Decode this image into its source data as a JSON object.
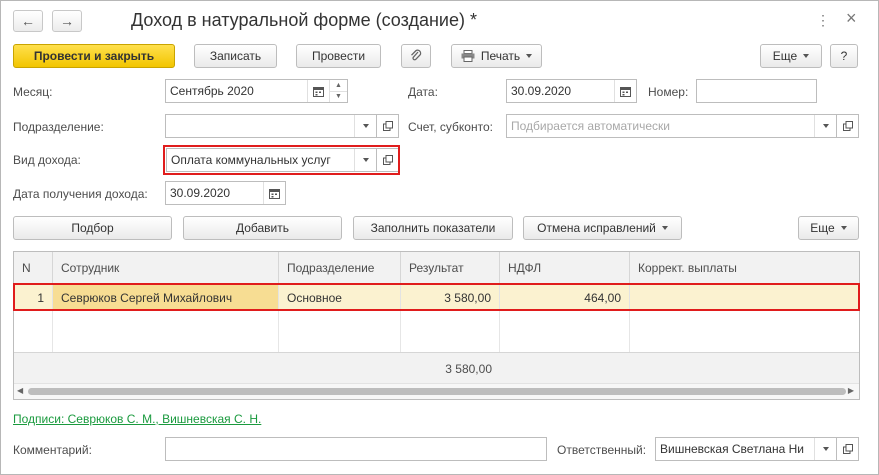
{
  "window": {
    "title": "Доход в натуральной форме (создание) *",
    "back_glyph": "←",
    "forward_glyph": "→",
    "menu_glyph": "⋮",
    "close_glyph": "×"
  },
  "toolbar": {
    "post_close": "Провести и закрыть",
    "save": "Записать",
    "post": "Провести",
    "print": "Печать",
    "more": "Еще",
    "help": "?"
  },
  "form": {
    "month_label": "Месяц:",
    "month_value": "Сентябрь 2020",
    "date_label": "Дата:",
    "date_value": "30.09.2020",
    "number_label": "Номер:",
    "number_value": "",
    "division_label": "Подразделение:",
    "division_value": "",
    "account_label": "Счет, субконто:",
    "account_placeholder": "Подбирается автоматически",
    "income_type_label": "Вид дохода:",
    "income_type_value": "Оплата коммунальных услуг",
    "income_date_label": "Дата получения дохода:",
    "income_date_value": "30.09.2020"
  },
  "table_toolbar": {
    "pick": "Подбор",
    "add": "Добавить",
    "fill": "Заполнить показатели",
    "cancel_corrections": "Отмена исправлений",
    "more": "Еще"
  },
  "table": {
    "columns": [
      "N",
      "Сотрудник",
      "Подразделение",
      "Результат",
      "НДФЛ",
      "Коррект. выплаты"
    ],
    "rows": [
      {
        "n": "1",
        "employee": "Севрюков Сергей Михайлович",
        "division": "Основное",
        "result": "3 580,00",
        "ndfl": "464,00",
        "correction": ""
      }
    ],
    "total_result": "3 580,00"
  },
  "footer": {
    "signatures_link": "Подписи: Севрюков С. М., Вишневская С. Н.",
    "comment_label": "Комментарий:",
    "comment_value": "",
    "responsible_label": "Ответственный:",
    "responsible_value": "Вишневская Светлана Ни"
  },
  "colors": {
    "primary_button": "#f2c500",
    "highlight_border": "#e01c1c",
    "selected_row": "#fbf2d0",
    "link": "#1a9a3e"
  }
}
